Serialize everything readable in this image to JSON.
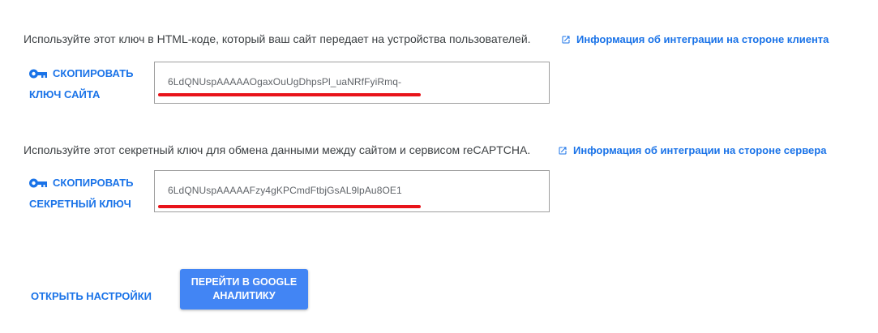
{
  "site_key_section": {
    "description": "Используйте этот ключ в HTML-коде, который ваш сайт передает на устройства пользователей.",
    "integration_link": "Информация об интеграции на стороне клиента",
    "copy_button": {
      "line1": "СКОПИРОВАТЬ",
      "line2": "КЛЮЧ САЙТА"
    },
    "key_value": "6LdQNUspAAAAAOgaxOuUgDhpsPl_uaNRfFyiRmq-"
  },
  "secret_key_section": {
    "description": "Используйте этот секретный ключ для обмена данными между сайтом и сервисом reCAPTCHA.",
    "integration_link": "Информация об интеграции на стороне сервера",
    "copy_button": {
      "line1": "СКОПИРОВАТЬ",
      "line2": "СЕКРЕТНЫЙ КЛЮЧ"
    },
    "key_value": "6LdQNUspAAAAAFzy4gKPCmdFtbjGsAL9lpAu8OE1"
  },
  "footer": {
    "settings_link": "ОТКРЫТЬ НАСТРОЙКИ",
    "primary_button": "ПЕРЕЙТИ В GOOGLE АНАЛИТИКУ"
  },
  "icons": {
    "copy": "key-icon",
    "external": "open-in-new-icon"
  },
  "colors": {
    "accent": "#1a73e8",
    "primary_button": "#4285f4",
    "redaction_underline": "#e8141a",
    "text": "#3c4043",
    "key_text": "#5f6368"
  }
}
